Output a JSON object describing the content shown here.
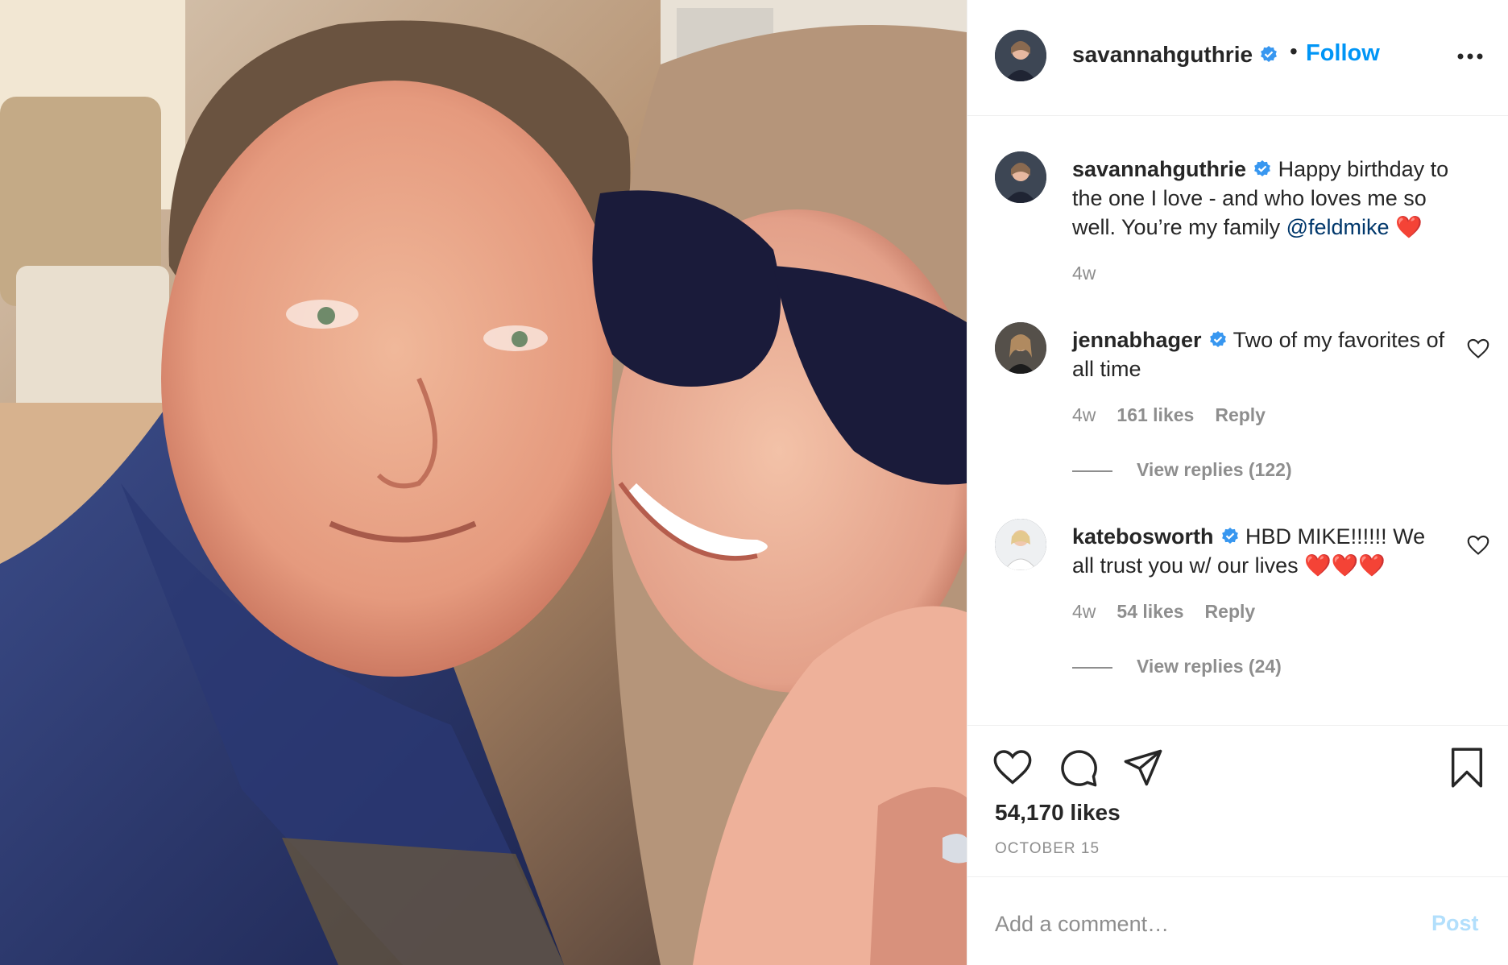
{
  "post": {
    "author": "savannahguthrie",
    "follow_label": "Follow",
    "separator": "•",
    "photo_description_icon": "photo",
    "caption": {
      "username": "savannahguthrie",
      "text": "Happy birthday to the one I love - and who loves me so well. You’re my family ",
      "mention": "@feldmike",
      "emoji": "❤️",
      "age": "4w"
    }
  },
  "comments": [
    {
      "username": "jennabhager",
      "text": "Two of my favorites of all time",
      "age": "4w",
      "likes": "161 likes",
      "reply_label": "Reply",
      "view_replies": "View replies (122)"
    },
    {
      "username": "katebosworth",
      "text": "HBD MIKE!!!!!! We all trust you w/ our lives ❤️❤️❤️",
      "age": "4w",
      "likes": "54 likes",
      "reply_label": "Reply",
      "view_replies": "View replies (24)"
    }
  ],
  "actions": {
    "likes_count": "54,170 likes",
    "date": "OCTOBER 15",
    "icons": [
      "heart-icon",
      "comment-icon",
      "share-icon",
      "bookmark-icon"
    ]
  },
  "add_comment": {
    "placeholder": "Add a comment…",
    "post_label": "Post"
  },
  "colors": {
    "accent": "#0095f6",
    "muted": "#8e8e8e",
    "mention": "#00376b",
    "post_disabled": "#b2dffc"
  }
}
